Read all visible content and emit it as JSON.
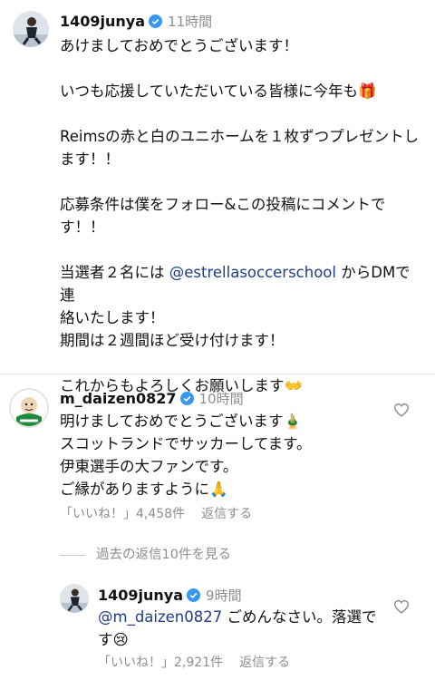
{
  "post": {
    "username": "1409junya",
    "time": "11時間",
    "caption_lines": [
      "あけましておめでとうございます！",
      "",
      "いつも応援していただいている皆様に今年も🎁",
      "",
      "Reimsの赤と白のユニホームを１枚ずつプレゼントし",
      "ます！！",
      "",
      "応募条件は僕をフォロー&この投稿にコメントで",
      "す！！",
      "",
      "当選者２名には ",
      "絡いたします！",
      "期間は２週間ほど受け付けます！",
      "",
      "これからもよろしくお願いします👐"
    ],
    "mention": "@estrellasoccerschool",
    "mention_suffix": " からDMで連"
  },
  "comment": {
    "username": "m_daizen0827",
    "time": "10時間",
    "lines": [
      "明けましておめでとうございます🎍",
      "スコットランドでサッカーしてます。",
      "伊東選手の大ファンです。",
      "ご縁がありますように🙏"
    ],
    "likes": "「いいね！」4,458件",
    "reply_label": "返信する"
  },
  "view_replies": "過去の返信10件を見る",
  "reply": {
    "username": "1409junya",
    "time": "9時間",
    "mention": "@m_daizen0827",
    "text_line1": " ごめんなさい。落選で",
    "text_line2": "す😢",
    "likes": "「いいね！」2,921件",
    "reply_label": "返信する"
  },
  "colors": {
    "verified": "#3897f0",
    "mention": "#1f3c88",
    "secondary": "#8e8e8e"
  }
}
